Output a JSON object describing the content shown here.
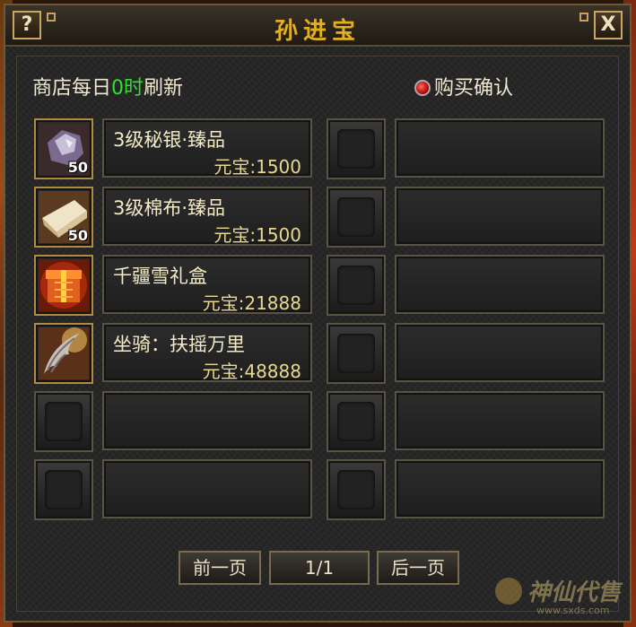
{
  "window": {
    "title": "孙进宝",
    "help_label": "?",
    "close_label": "X"
  },
  "shop": {
    "refresh_prefix": "商店每日",
    "refresh_hour": "0时",
    "refresh_suffix": "刷新",
    "confirm_label": "购买确认"
  },
  "items": [
    {
      "name": "3级秘银·臻品",
      "price_label": "元宝:1500",
      "qty": "50",
      "icon": "silver-ore-icon",
      "color": "#9a8aa8"
    },
    {
      "name": "3级棉布·臻品",
      "price_label": "元宝:1500",
      "qty": "50",
      "icon": "cotton-cloth-icon",
      "color": "#e0cfa8"
    },
    {
      "name": "千疆雪礼盒",
      "price_label": "元宝:21888",
      "qty": "",
      "icon": "gift-box-icon",
      "color": "#e05010"
    },
    {
      "name": "坐骑：扶摇万里",
      "price_label": "元宝:48888",
      "qty": "",
      "icon": "mount-wing-icon",
      "color": "#b0a090"
    }
  ],
  "pager": {
    "prev_label": "前一页",
    "page_label": "1/1",
    "next_label": "后一页"
  },
  "watermark": {
    "text": "神仙代售",
    "url": "www.sxds.com"
  }
}
